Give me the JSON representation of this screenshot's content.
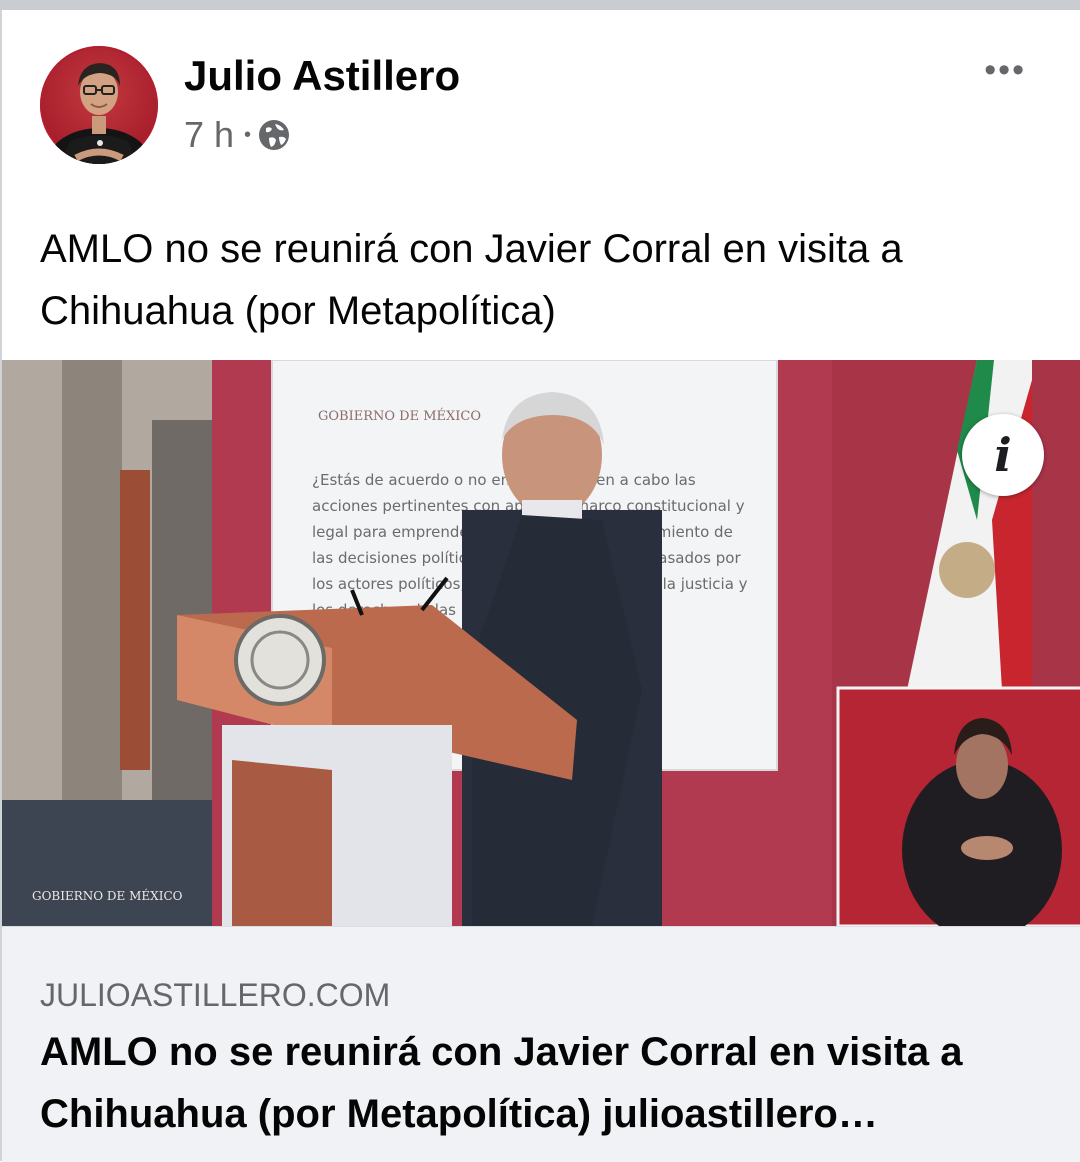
{
  "post": {
    "author": "Julio Astillero",
    "time": "7 h",
    "separator": "•",
    "privacy_icon": "globe-icon",
    "more_label": "•••",
    "text": "AMLO no se reunirá con Javier Corral en visita a Chihuahua (por Metapolítica)"
  },
  "image": {
    "info_label": "i",
    "slide_header": "GOBIERNO DE MÉXICO",
    "slide_text": "¿Estás de acuerdo o no en que se lleven a cabo las acciones pertinentes con apego al marco constitucional y legal para emprender un proceso de esclarecimiento de las decisiones políticas tomadas en los años pasados por los actores políticos, encaminado a garantizar la justicia y los derechos de las posibles víctimas?",
    "watermark": "GOBIERNO DE MÉXICO"
  },
  "link": {
    "domain": "JULIOASTILLERO.COM",
    "title": "AMLO no se reunirá con Javier Corral en visita a Chihuahua (por Metapolítica) julioastillero…"
  },
  "colors": {
    "secondary_text": "#65676b",
    "link_bg": "#f0f2f5",
    "backdrop_red": "#a83b4d"
  }
}
